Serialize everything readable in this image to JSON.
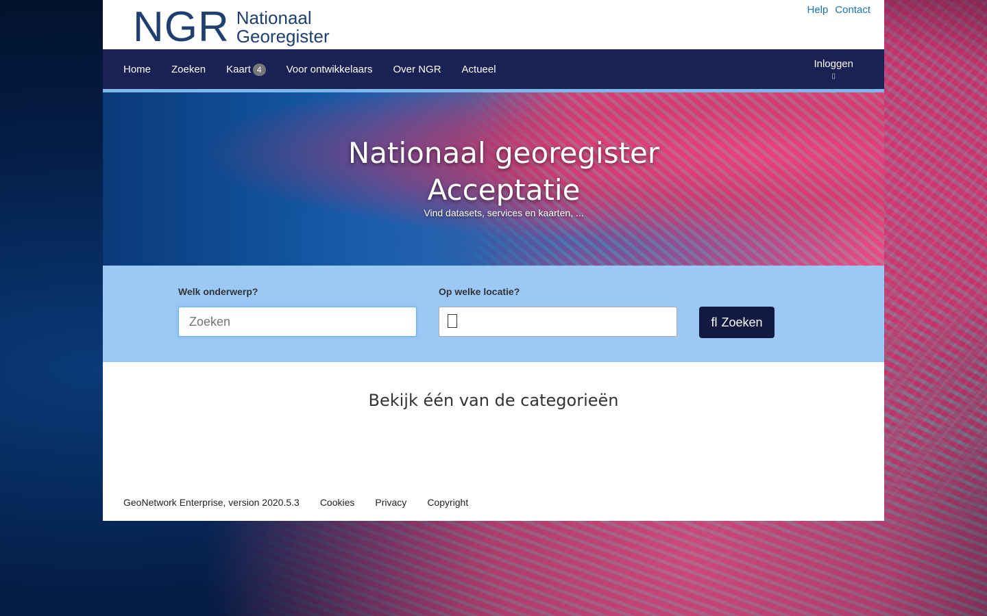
{
  "header": {
    "logo_mark": "NGR",
    "logo_line1": "Nationaal",
    "logo_line2": "Georegister",
    "links": {
      "help": "Help",
      "contact": "Contact"
    }
  },
  "nav": {
    "items": [
      "Home",
      "Zoeken",
      "Kaart",
      "Voor ontwikkelaars",
      "Over NGR",
      "Actueel"
    ],
    "kaart_badge": "4",
    "login": "Inloggen",
    "login_icon": "user-icon"
  },
  "hero": {
    "title_line1": "Nationaal georegister",
    "title_line2": "Acceptatie",
    "subtitle": "Vind datasets, services en kaarten, ..."
  },
  "search": {
    "topic_label": "Welk onderwerp?",
    "topic_placeholder": "Zoeken",
    "location_label": "Op welke locatie?",
    "location_value": "",
    "location_icon": "map-marker-icon",
    "button_label": "Zoeken",
    "button_icon": "search-icon"
  },
  "content": {
    "categories_title": "Bekijk één van de categorieën"
  },
  "footer": {
    "version": "GeoNetwork Enterprise, version 2020.5.3",
    "cookies": "Cookies",
    "privacy": "Privacy",
    "copyright": "Copyright"
  },
  "colors": {
    "nav_bg": "#1a2155",
    "nav_border": "#7eb7ea",
    "search_bg": "#9bc8f4",
    "button_bg": "#131a42",
    "link": "#1a73b8",
    "logo": "#1f3f6e"
  }
}
